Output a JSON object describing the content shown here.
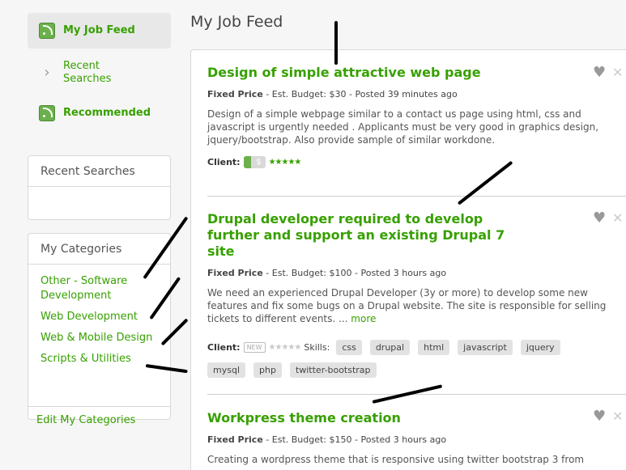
{
  "nav": {
    "items": [
      {
        "label": "My Job Feed",
        "icon": "rss-icon"
      },
      {
        "label": "Recent\nSearches",
        "icon": "chevron-right-icon"
      },
      {
        "label": "Recommended",
        "icon": "rss-icon"
      }
    ]
  },
  "recent_searches": {
    "title": "Recent Searches"
  },
  "categories": {
    "title": "My Categories",
    "items": [
      "Other - Software Development",
      "Web Development",
      "Web & Mobile Design",
      "Scripts & Utilities"
    ],
    "edit_label": "Edit My Categories"
  },
  "page": {
    "title": "My Job Feed"
  },
  "jobs": [
    {
      "title": "Design of simple attractive web page",
      "type": "Fixed Price",
      "meta": " - Est. Budget: $30 - Posted 39 minutes ago",
      "description": "Design of a simple webpage similar to a contact us page using html, css and javascript is urgently needed . Applicants must be very good in graphics design, jquery/bootstrap. Also provide sample of similar workdone.",
      "client_label": "Client:",
      "payment_symbol": "$",
      "stars": "★★★★★"
    },
    {
      "title": "Drupal developer required to develop further and support an existing Drupal 7 site",
      "type": "Fixed Price",
      "meta": " - Est. Budget: $100 - Posted 3 hours ago",
      "description": "We need an experienced Drupal Developer (3y or more) to develop some new features and fix some bugs on a Drupal website. The site is responsible for selling tickets to different events. ...",
      "more_label": "more",
      "client_label": "Client:",
      "new_badge": "NEW",
      "stars": "★★★★★",
      "skills_label": "Skills:",
      "skills": [
        "css",
        "drupal",
        "html",
        "javascript",
        "jquery",
        "mysql",
        "php",
        "twitter-bootstrap"
      ]
    },
    {
      "title": "Workpress theme creation",
      "type": "Fixed Price",
      "meta": " - Est. Budget: $150 - Posted 3 hours ago",
      "description": "Creating a wordpress theme that is responsive using twitter bootstrap 3 from"
    }
  ],
  "icons": {
    "heart": "♥",
    "close": "✕",
    "chevron": "›"
  },
  "colors": {
    "accent": "#37a000",
    "rss": "#6ab04c"
  }
}
